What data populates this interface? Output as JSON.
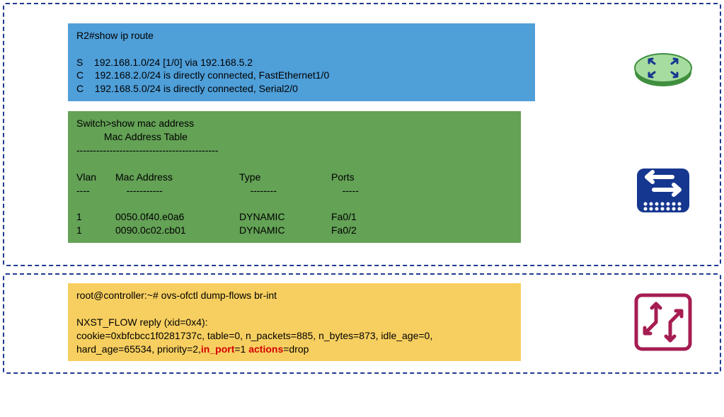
{
  "route": {
    "prompt": "R2#show ip route",
    "entries": [
      {
        "code": "S",
        "text": "192.168.1.0/24 [1/0] via 192.168.5.2"
      },
      {
        "code": "C",
        "text": "192.168.2.0/24 is directly connected, FastEthernet1/0"
      },
      {
        "code": "C",
        "text": "192.168.5.0/24 is directly connected, Serial2/0"
      }
    ]
  },
  "mac": {
    "prompt": "Switch>show mac address",
    "title": "Mac Address Table",
    "separator": "-------------------------------------------",
    "headers": {
      "vlan": "Vlan",
      "mac": "Mac Address",
      "type": "Type",
      "ports": "Ports"
    },
    "dashes": {
      "vlan": "----",
      "mac": "-----------",
      "type": "--------",
      "ports": "-----"
    },
    "rows": [
      {
        "vlan": "1",
        "mac": "0050.0f40.e0a6",
        "type": "DYNAMIC",
        "ports": "Fa0/1"
      },
      {
        "vlan": "1",
        "mac": "0090.0c02.cb01",
        "type": "DYNAMIC",
        "ports": "Fa0/2"
      }
    ]
  },
  "ovs": {
    "prompt": "root@controller:~# ovs-ofctl dump-flows br-int",
    "reply": "NXST_FLOW reply (xid=0x4):",
    "body_pre": " cookie=0xbfcbcc1f0281737c, table=0, n_packets=885, n_bytes=873, idle_age=0, hard_age=65534, priority=2,",
    "in_port_label": "in_port",
    "in_port_val": "=1 ",
    "actions_label": "actions",
    "actions_val": "=drop"
  },
  "icons": {
    "router": "router-icon",
    "switch": "switch-icon",
    "ovs": "openflow-switch-icon"
  },
  "colors": {
    "route_bg": "#4f9fd9",
    "mac_bg": "#64a256",
    "ovs_bg": "#f7cf60",
    "border": "#1f3a93",
    "highlight": "#d40000",
    "router_fill": "#a7dca0",
    "router_stroke": "#3f8f3f",
    "switch_fill": "#16378f",
    "ofswitch_stroke": "#a51d52"
  }
}
